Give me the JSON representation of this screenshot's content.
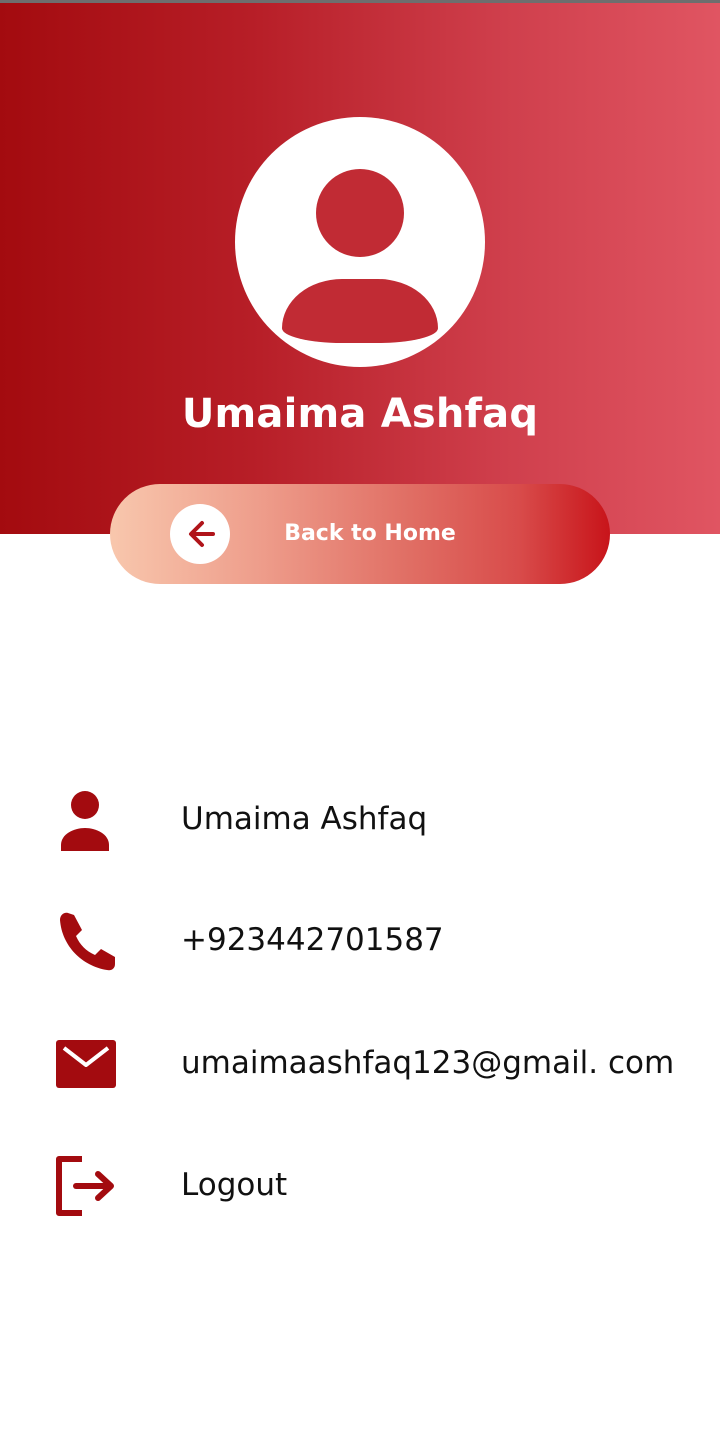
{
  "profile": {
    "name": "Umaima Ashfaq"
  },
  "back_button": {
    "label": "Back to Home"
  },
  "details": {
    "name": "Umaima Ashfaq",
    "phone": "+923442701587",
    "email": "umaimaashfaq123@gmail. com",
    "logout_label": "Logout"
  },
  "icons": {
    "avatar": "user-avatar-icon",
    "back": "arrow-left-icon",
    "person": "person-icon",
    "phone": "phone-icon",
    "email": "mail-icon",
    "logout": "logout-icon"
  },
  "colors": {
    "primary": "#a30b0f",
    "header_gradient_start": "#a30b0f",
    "header_gradient_end": "#e05562",
    "button_gradient_start": "#f8c7ad",
    "button_gradient_end": "#c8141a",
    "text": "#111111"
  }
}
